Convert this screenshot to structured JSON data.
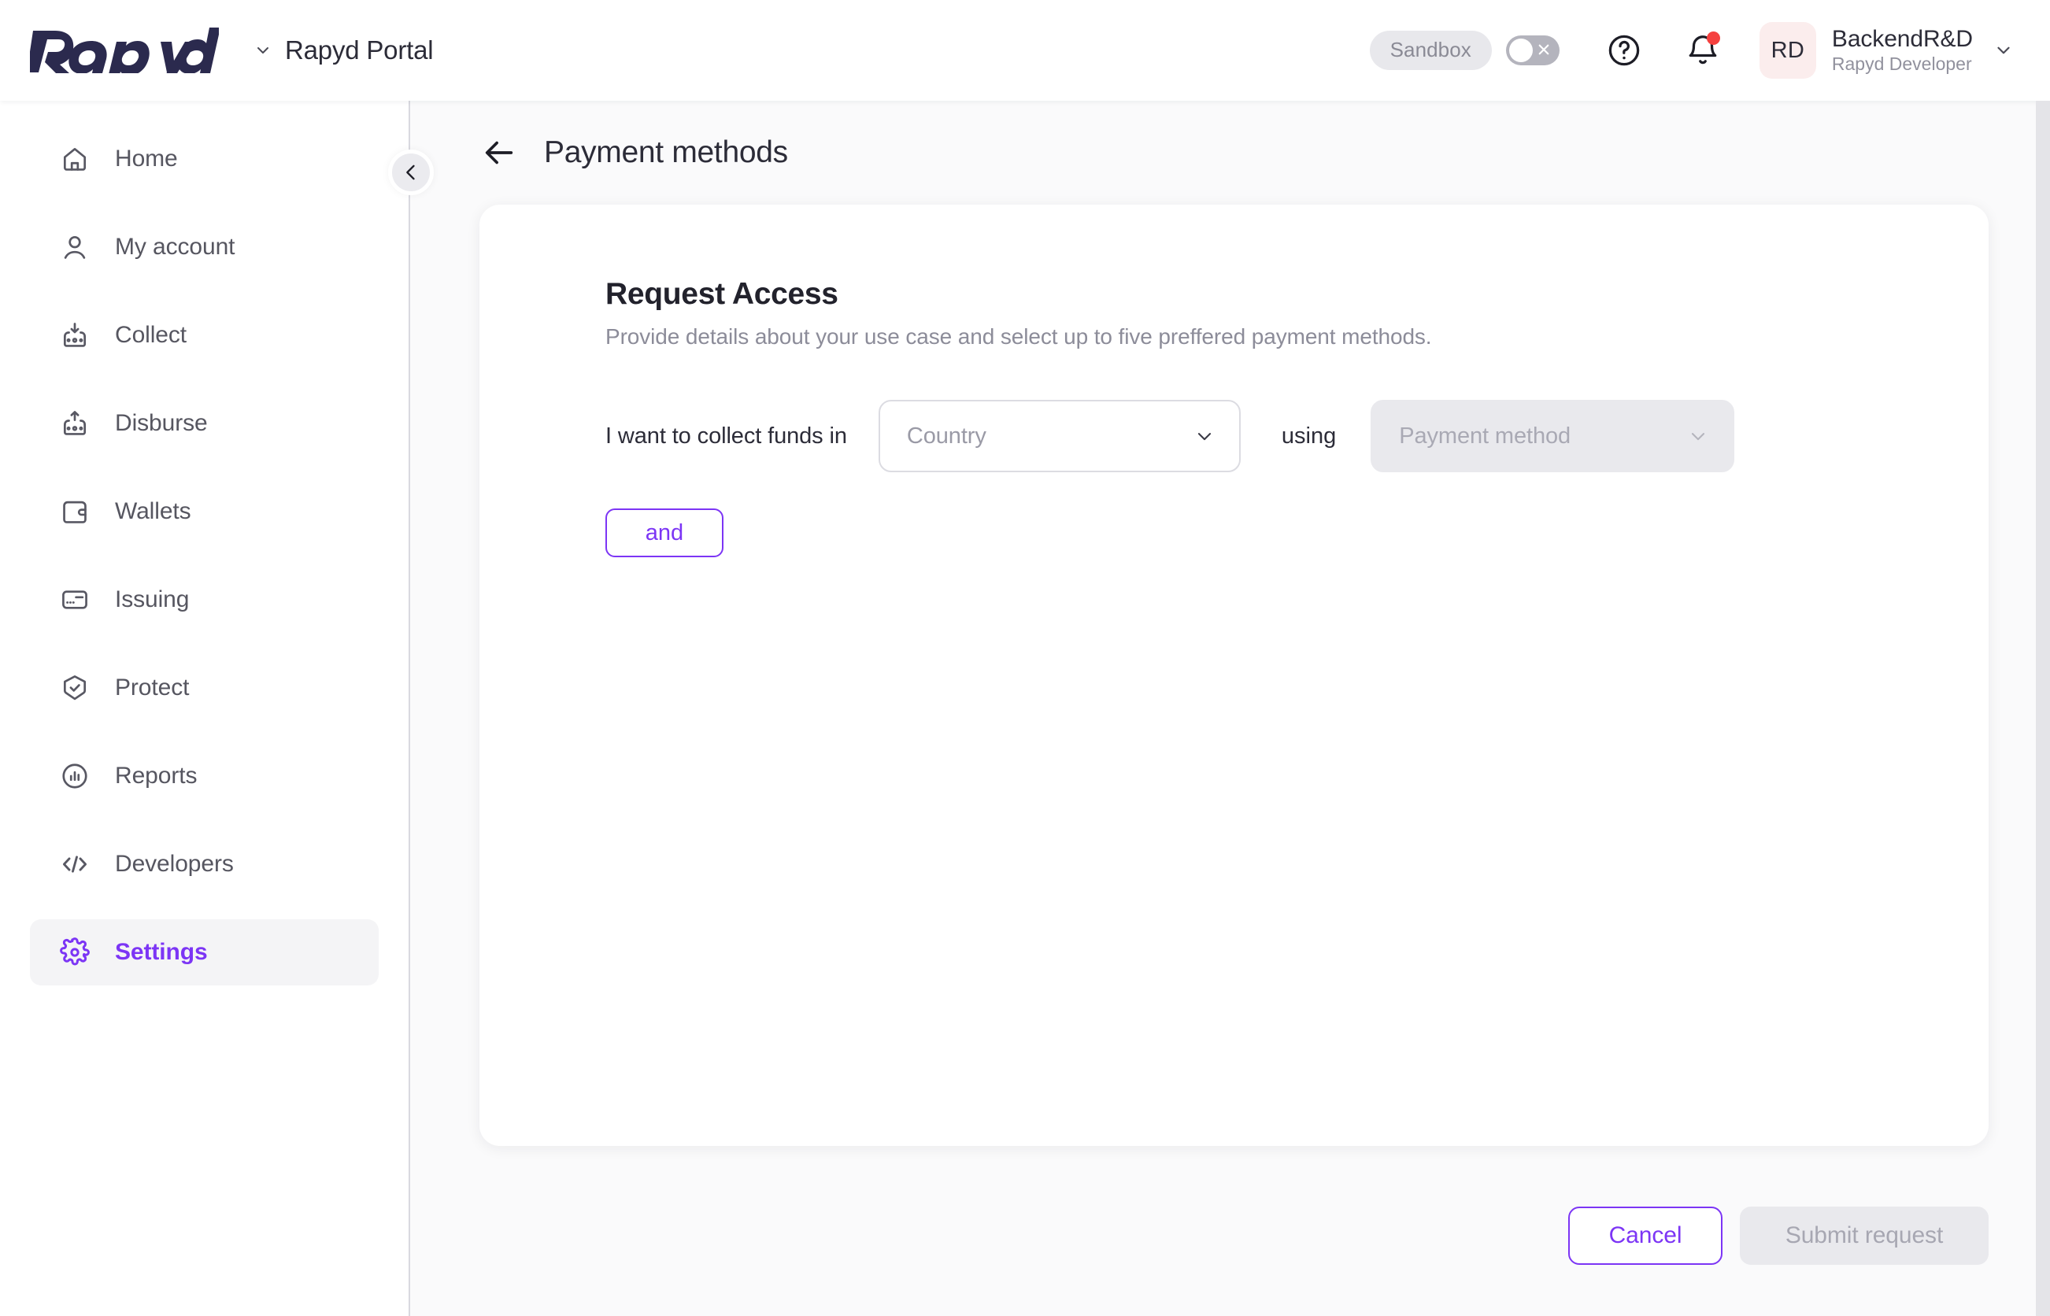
{
  "header": {
    "logo_text": "Rapyd",
    "portal_name": "Rapyd Portal",
    "portal_chevron_icon": "chevron-down-icon",
    "environment": {
      "label": "Sandbox",
      "toggle_state": "off",
      "toggle_x_icon": "close-icon"
    },
    "help_icon": "question-circle-icon",
    "notifications_icon": "bell-icon",
    "notifications_has_unread": true,
    "user": {
      "initials": "RD",
      "name": "BackendR&D",
      "role": "Rapyd Developer",
      "avatar_bg": "#FBEDED",
      "chevron_icon": "chevron-down-icon"
    }
  },
  "sidebar": {
    "collapse_icon": "chevron-left-icon",
    "active_accent": "#7C35F5",
    "items": [
      {
        "label": "Home",
        "icon": "home-icon",
        "active": false
      },
      {
        "label": "My account",
        "icon": "user-icon",
        "active": false
      },
      {
        "label": "Collect",
        "icon": "collect-arrow-down-icon",
        "active": false
      },
      {
        "label": "Disburse",
        "icon": "disburse-arrow-up-icon",
        "active": false
      },
      {
        "label": "Wallets",
        "icon": "wallet-icon",
        "active": false
      },
      {
        "label": "Issuing",
        "icon": "card-icon",
        "active": false
      },
      {
        "label": "Protect",
        "icon": "shield-check-icon",
        "active": false
      },
      {
        "label": "Reports",
        "icon": "chart-circle-icon",
        "active": false
      },
      {
        "label": "Developers",
        "icon": "code-brackets-icon",
        "active": false
      },
      {
        "label": "Settings",
        "icon": "gear-icon",
        "active": true
      }
    ]
  },
  "page": {
    "back_icon": "arrow-left-icon",
    "title": "Payment methods"
  },
  "card": {
    "title": "Request Access",
    "subtitle": "Provide details about your use case and select up to five preffered payment methods.",
    "rule": {
      "prefix_text": "I want to collect funds in",
      "country_select": {
        "placeholder": "Country",
        "value": "",
        "chevron_icon": "chevron-down-icon",
        "disabled": false
      },
      "middle_text": "using",
      "method_select": {
        "placeholder": "Payment method",
        "value": "",
        "chevron_icon": "chevron-down-icon",
        "disabled": true
      }
    },
    "and_button": "and"
  },
  "footer": {
    "cancel_label": "Cancel",
    "submit_label": "Submit request",
    "submit_disabled": true
  }
}
